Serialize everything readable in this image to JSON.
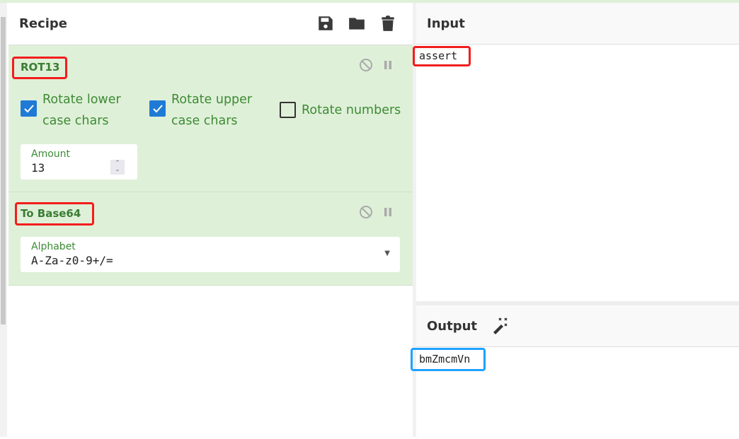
{
  "recipe": {
    "title": "Recipe",
    "icons": [
      "save-icon",
      "folder-icon",
      "trash-icon"
    ]
  },
  "operations": [
    {
      "name": "ROT13",
      "options": [
        {
          "label": "Rotate lower case chars",
          "line1": "Rotate lower",
          "line2": "case chars",
          "checked": true
        },
        {
          "label": "Rotate upper case chars",
          "line1": "Rotate upper",
          "line2": "case chars",
          "checked": true
        },
        {
          "label": "Rotate numbers",
          "checked": false
        }
      ],
      "amount": {
        "label": "Amount",
        "value": "13"
      }
    },
    {
      "name": "To Base64",
      "alphabet": {
        "label": "Alphabet",
        "value": "A-Za-z0-9+/="
      }
    }
  ],
  "input": {
    "title": "Input",
    "value": "assert"
  },
  "output": {
    "title": "Output",
    "value": "bmZmcmVn",
    "icon": "magic-wand-icon"
  },
  "colors": {
    "operation_bg": "#dff0d8",
    "operation_text": "#3d8b35",
    "highlight_red": "#f21d1d",
    "highlight_blue": "#1ea1ff"
  }
}
